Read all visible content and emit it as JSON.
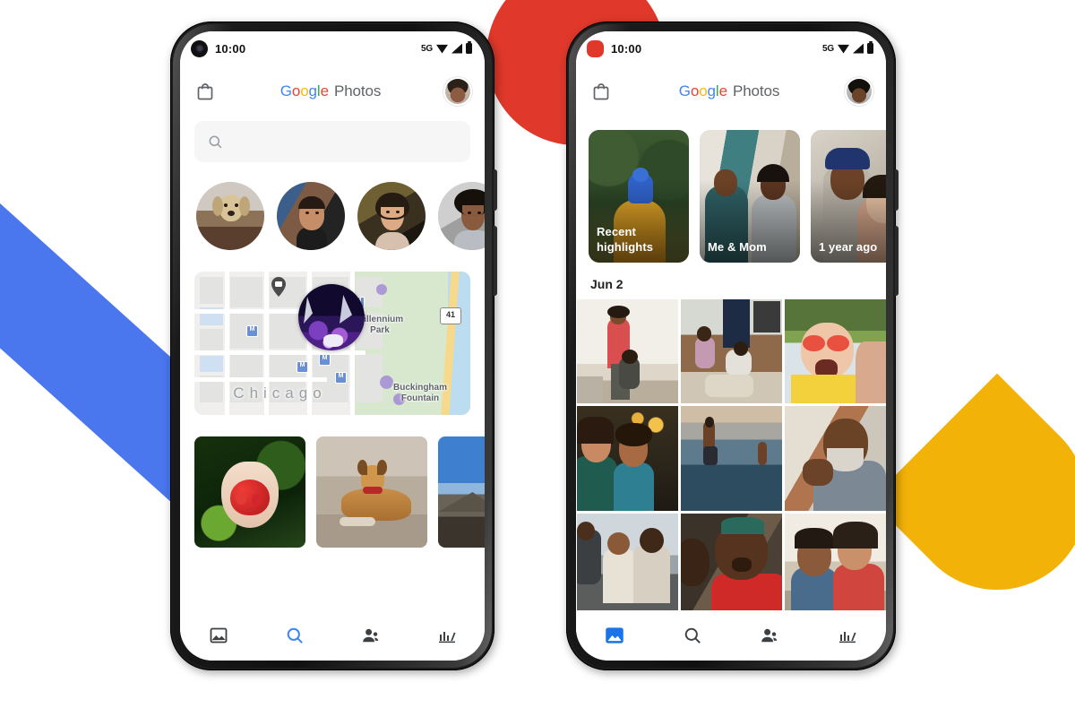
{
  "scene": {
    "title": "Google Photos app on two Pixel phones",
    "background": "#ffffff"
  },
  "decor": {
    "red_circle": "#E0392B",
    "yellow_half_circle": "#F2B207",
    "blue_diagonal_band": "#4A76EE"
  },
  "brand": {
    "g1": "G",
    "g2": "o",
    "g3": "o",
    "g4": "g",
    "g5": "l",
    "g6": "e",
    "product": "Photos",
    "colors": {
      "blue": "#4285F4",
      "red": "#EA4335",
      "yellow": "#FBBC05",
      "green": "#34A853",
      "gray": "#5f6368"
    }
  },
  "phone_left": {
    "status": {
      "clock": "10:00",
      "network": "5G",
      "icons": [
        "wifi-icon",
        "signal-icon",
        "battery-icon"
      ],
      "punch_hole": "camera-punch-hole"
    },
    "appbar": {
      "store_icon": "shopping-bag-icon",
      "avatar": "account-avatar"
    },
    "search": {
      "icon": "search-icon",
      "value": "",
      "placeholder": ""
    },
    "people": [
      {
        "name": "dog-face",
        "label": "Dog"
      },
      {
        "name": "man-face",
        "label": "Man"
      },
      {
        "name": "woman-face",
        "label": "Woman"
      },
      {
        "name": "woman-2-face",
        "label": "Woman 2"
      }
    ],
    "map": {
      "city": "Chicago",
      "places": [
        "Millennium Park",
        "Buckingham Fountain"
      ],
      "highway_shield": "41",
      "pin_icon": "map-pin-icon",
      "transit_icon": "metro-station-icon",
      "photo_bubble": "location-photo-bubble"
    },
    "strip": [
      {
        "name": "photo-strawberries",
        "label": "Hands holding strawberries"
      },
      {
        "name": "photo-dog-beach",
        "label": "Dog on sand"
      },
      {
        "name": "photo-mountain",
        "label": "Mountain landscape"
      }
    ],
    "nav": [
      {
        "name": "tab-photos",
        "icon": "photos-icon",
        "active": false
      },
      {
        "name": "tab-search",
        "icon": "search-icon",
        "active": true
      },
      {
        "name": "tab-sharing",
        "icon": "people-icon",
        "active": false
      },
      {
        "name": "tab-library",
        "icon": "library-icon",
        "active": false
      }
    ]
  },
  "phone_right": {
    "status": {
      "clock": "10:00",
      "network": "5G",
      "icons": [
        "wifi-icon",
        "signal-icon",
        "battery-icon"
      ],
      "punch_hole": "camera-punch-hole-red"
    },
    "appbar": {
      "store_icon": "shopping-bag-icon",
      "avatar": "account-avatar"
    },
    "memories": [
      {
        "name": "memory-recent-highlights",
        "label": "Recent highlights"
      },
      {
        "name": "memory-me-and-mom",
        "label": "Me & Mom"
      },
      {
        "name": "memory-1-year-ago",
        "label": "1 year ago"
      }
    ],
    "date_header": "Jun 2",
    "grid": [
      {
        "name": "photo-mother-child-livingroom"
      },
      {
        "name": "photo-kids-kitchen-floor"
      },
      {
        "name": "photo-girl-sunglasses-pool"
      },
      {
        "name": "photo-couple-dinner-lights"
      },
      {
        "name": "photo-boy-jumping-lake"
      },
      {
        "name": "photo-man-laughing"
      },
      {
        "name": "photo-family-sofa"
      },
      {
        "name": "photo-child-red-shirt"
      },
      {
        "name": "photo-father-daughter-kiss"
      }
    ],
    "nav": [
      {
        "name": "tab-photos",
        "icon": "photos-icon",
        "active": true
      },
      {
        "name": "tab-search",
        "icon": "search-icon",
        "active": false
      },
      {
        "name": "tab-sharing",
        "icon": "people-icon",
        "active": false
      },
      {
        "name": "tab-library",
        "icon": "library-icon",
        "active": false
      }
    ]
  }
}
